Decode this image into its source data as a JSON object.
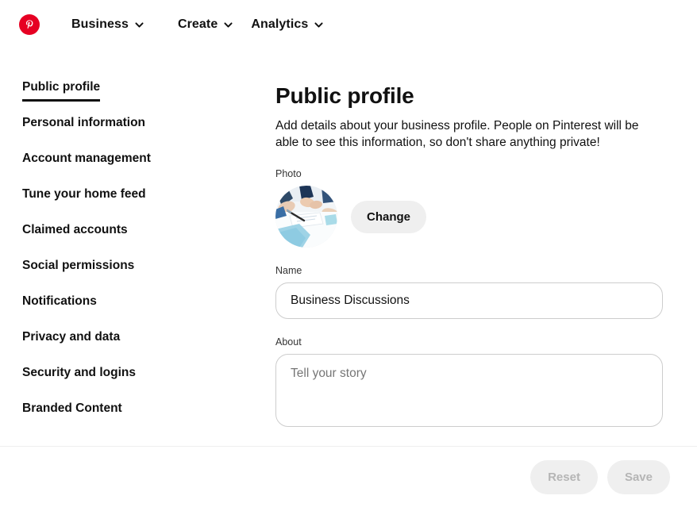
{
  "brand": {
    "logo_icon": "pinterest-logo-icon",
    "accent_color": "#e60023"
  },
  "topnav": {
    "items": [
      {
        "label": "Business",
        "icon": "chevron-down-icon"
      },
      {
        "label": "Create",
        "icon": "chevron-down-icon"
      },
      {
        "label": "Analytics",
        "icon": "chevron-down-icon"
      }
    ]
  },
  "sidebar": {
    "items": [
      {
        "label": "Public profile",
        "active": true
      },
      {
        "label": "Personal information",
        "active": false
      },
      {
        "label": "Account management",
        "active": false
      },
      {
        "label": "Tune your home feed",
        "active": false
      },
      {
        "label": "Claimed accounts",
        "active": false
      },
      {
        "label": "Social permissions",
        "active": false
      },
      {
        "label": "Notifications",
        "active": false
      },
      {
        "label": "Privacy and data",
        "active": false
      },
      {
        "label": "Security and logins",
        "active": false
      },
      {
        "label": "Branded Content",
        "active": false
      }
    ]
  },
  "main": {
    "title": "Public profile",
    "description": "Add details about your business profile. People on Pinterest will be able to see this information, so don't share anything private!",
    "photo": {
      "label": "Photo",
      "avatar_icon": "profile-photo-business-meeting",
      "change_button": "Change"
    },
    "name": {
      "label": "Name",
      "value": "Business Discussions",
      "placeholder": ""
    },
    "about": {
      "label": "About",
      "value": "",
      "placeholder": "Tell your story"
    }
  },
  "footer": {
    "reset_label": "Reset",
    "save_label": "Save",
    "button_text_color": "#b5b5b5",
    "button_bg_color": "#efefef"
  }
}
